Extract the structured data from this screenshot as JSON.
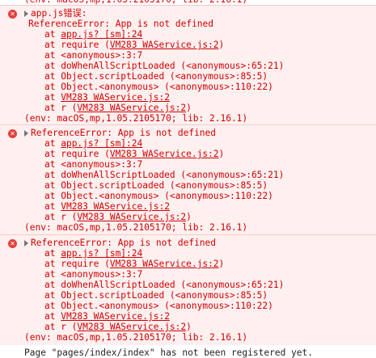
{
  "top_partial": "(env: macOS,mp,1.05.2105170; lib: 2.16.1)",
  "entries": [
    {
      "header": "app.js错误:",
      "message": "ReferenceError: App is not defined",
      "frames": [
        {
          "pre": "at ",
          "link": "app.js? [sm]:24",
          "post": ""
        },
        {
          "pre": "at require (",
          "link": "VM283 WAService.js:2",
          "post": ")"
        },
        {
          "pre": "at <anonymous>:3:7",
          "link": "",
          "post": ""
        },
        {
          "pre": "at doWhenAllScriptLoaded (<anonymous>:65:21)",
          "link": "",
          "post": ""
        },
        {
          "pre": "at Object.scriptLoaded (<anonymous>:85:5)",
          "link": "",
          "post": ""
        },
        {
          "pre": "at Object.<anonymous> (<anonymous>:110:22)",
          "link": "",
          "post": ""
        },
        {
          "pre": "at ",
          "link": "VM283 WAService.js:2",
          "post": ""
        },
        {
          "pre": "at r (",
          "link": "VM283 WAService.js:2",
          "post": ")"
        }
      ],
      "env": "(env: macOS,mp,1.05.2105170; lib: 2.16.1)"
    },
    {
      "header": "",
      "message": "ReferenceError: App is not defined",
      "frames": [
        {
          "pre": "at ",
          "link": "app.js? [sm]:24",
          "post": ""
        },
        {
          "pre": "at require (",
          "link": "VM283 WAService.js:2",
          "post": ")"
        },
        {
          "pre": "at <anonymous>:3:7",
          "link": "",
          "post": ""
        },
        {
          "pre": "at doWhenAllScriptLoaded (<anonymous>:65:21)",
          "link": "",
          "post": ""
        },
        {
          "pre": "at Object.scriptLoaded (<anonymous>:85:5)",
          "link": "",
          "post": ""
        },
        {
          "pre": "at Object.<anonymous> (<anonymous>:110:22)",
          "link": "",
          "post": ""
        },
        {
          "pre": "at ",
          "link": "VM283 WAService.js:2",
          "post": ""
        },
        {
          "pre": "at r (",
          "link": "VM283 WAService.js:2",
          "post": ")"
        }
      ],
      "env": "(env: macOS,mp,1.05.2105170; lib: 2.16.1)"
    },
    {
      "header": "",
      "message": "ReferenceError: App is not defined",
      "frames": [
        {
          "pre": "at ",
          "link": "app.js? [sm]:24",
          "post": ""
        },
        {
          "pre": "at require (",
          "link": "VM283 WAService.js:2",
          "post": ")"
        },
        {
          "pre": "at <anonymous>:3:7",
          "link": "",
          "post": ""
        },
        {
          "pre": "at doWhenAllScriptLoaded (<anonymous>:65:21)",
          "link": "",
          "post": ""
        },
        {
          "pre": "at Object.scriptLoaded (<anonymous>:85:5)",
          "link": "",
          "post": ""
        },
        {
          "pre": "at Object.<anonymous> (<anonymous>:110:22)",
          "link": "",
          "post": ""
        },
        {
          "pre": "at ",
          "link": "VM283 WAService.js:2",
          "post": ""
        },
        {
          "pre": "at r (",
          "link": "VM283 WAService.js:2",
          "post": ")"
        }
      ],
      "env": "(env: macOS,mp,1.05.2105170; lib: 2.16.1)"
    }
  ],
  "bottom_partial": "Page \"pages/index/index\" has not been registered yet."
}
